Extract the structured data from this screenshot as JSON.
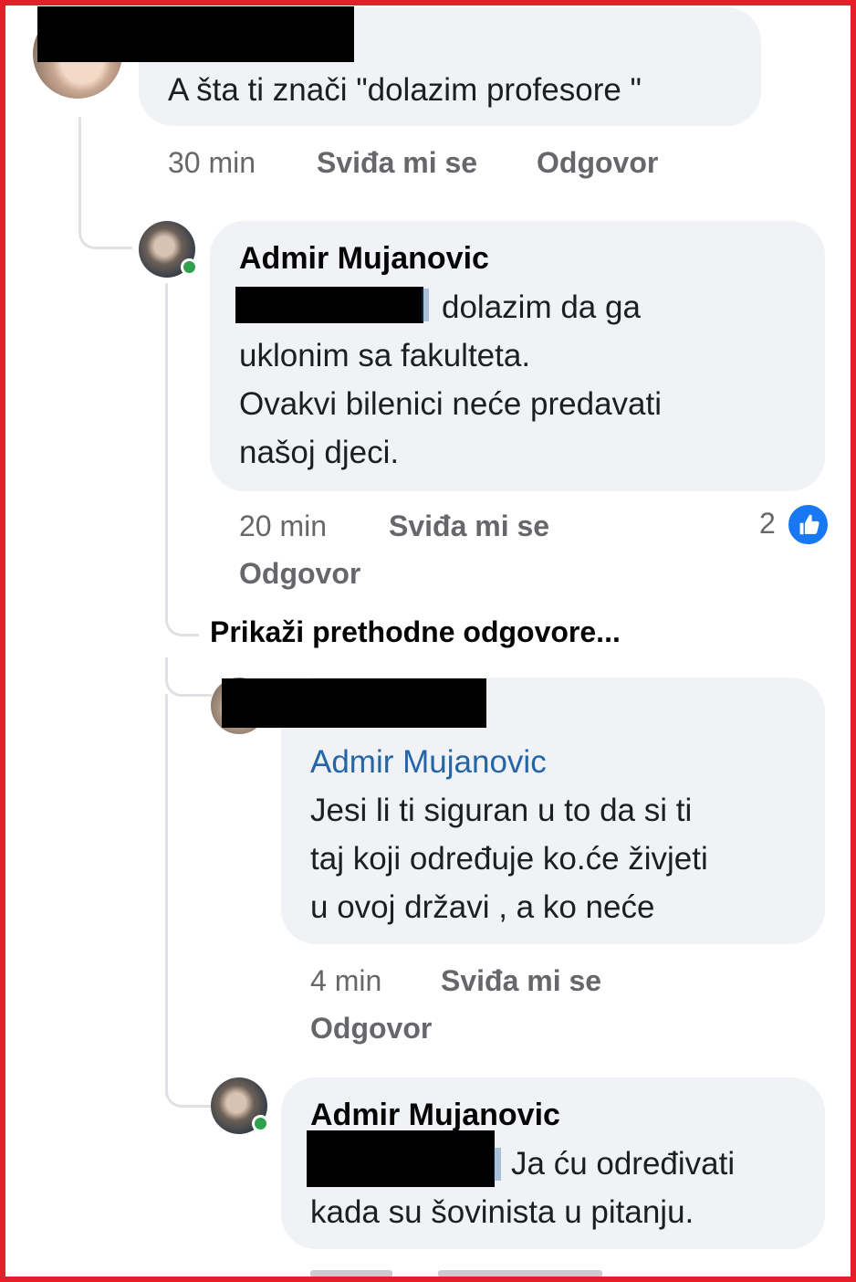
{
  "comments": [
    {
      "body": "A šta ti znači \"dolazim profesore \"",
      "time": "30 min",
      "like_label": "Sviđa mi se",
      "reply_label": "Odgovor"
    },
    {
      "author": "Admir Mujanovic",
      "body": "dolazim da ga\nuklonim sa fakulteta.\nOvakvi bilenici neće predavati\nnašoj djeci.",
      "time": "20 min",
      "like_label": "Sviđa mi se",
      "reply_label": "Odgovor",
      "reaction_count": "2"
    },
    {
      "mention": "Admir Mujanovic",
      "body": "Jesi li ti siguran u to da si ti\ntaj koji određuje ko.će živjeti\nu ovoj državi , a ko neće",
      "time": "4 min",
      "like_label": "Sviđa mi se",
      "reply_label": "Odgovor"
    },
    {
      "author": "Admir Mujanovic",
      "body": "Ja ću određivati\nkada su šovinista u pitanju."
    }
  ],
  "show_previous": "Prikaži prethodne odgovore...",
  "colors": {
    "frame": "#e3202a",
    "bubble": "#f0f2f5",
    "mention": "#2465a8",
    "like_blue": "#1877f2",
    "online": "#31a24c"
  }
}
